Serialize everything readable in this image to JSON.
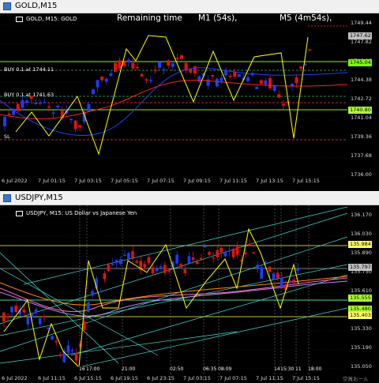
{
  "gold": {
    "title": "GOLD,M15",
    "symbol_line": "GOLD, M15:  GOLD",
    "timer": {
      "label": "Remaining time",
      "m1": "M1 (54s),",
      "m5": "M5 (4m54s),"
    },
    "orders": [
      "BUY 0.1 at 1744.11",
      "BUY 0.1 at 1741.63"
    ],
    "sl_label": "SL",
    "price_ticks": [
      "1749.44",
      "1747.82",
      "1746.08",
      "1744.38",
      "1742.72",
      "1741.04",
      "1739.36",
      "1737.68",
      "1736.00"
    ],
    "price_tags": [
      {
        "text": "1747.62",
        "bg": "#c0c0c0",
        "fg": "#000000"
      },
      {
        "text": "1745.04",
        "bg": "#7cfc00",
        "fg": "#000000"
      },
      {
        "text": "1740.80",
        "bg": "#adff2f",
        "fg": "#000000"
      }
    ],
    "time_labels": [
      "6 Jul 2022",
      "7 Jul 01:15",
      "7 Jul 03:15",
      "7 Jul 05:15",
      "7 Jul 07:15",
      "7 Jul 09:15",
      "7 Jul 11:15",
      "7 Jul 13:15",
      "7 Jul 15:15"
    ]
  },
  "usdjpy": {
    "title": "USDJPY,M15",
    "symbol_line": "USDJPY, M15:  US Dollar vs Japanese Yen",
    "price_ticks": [
      "136.170",
      "136.030",
      "135.890",
      "135.750",
      "135.610",
      "135.470",
      "135.330",
      "135.190",
      "135.050"
    ],
    "price_tags": [
      {
        "text": "135.984",
        "bg": "#ffff66",
        "fg": "#000000"
      },
      {
        "text": "135.797",
        "bg": "#c0c0c0",
        "fg": "#000000"
      },
      {
        "text": "135.555",
        "bg": "#adff2f",
        "fg": "#000000"
      },
      {
        "text": "135.480",
        "bg": "#adff2f",
        "fg": "#000000"
      },
      {
        "text": "135.403",
        "bg": "#ffff66",
        "fg": "#000000"
      }
    ],
    "vline_tags": [
      "16",
      "17:00",
      "21:00",
      "02:50",
      "06:35",
      "08:09",
      "14",
      "15:30",
      "11",
      "18:00"
    ],
    "time_labels": [
      "6 Jul 2022",
      "6 Jul 11:15",
      "6 Jul 15:15",
      "6 Jul 19:15",
      "6 Jul 23:15",
      "7 Jul 03:15",
      "7 Jul 07:15",
      "7 Jul 11:15",
      "7 Jul 15:15"
    ],
    "watermark": "空買おール"
  },
  "colors": {
    "bull": "#1e3cff",
    "bear": "#e81010",
    "zigzag": "#ffff00",
    "ma_red": "#ff2020",
    "ma_blue": "#2040ff",
    "fib": "#7cfc00",
    "channel": "#40e0d0"
  }
}
